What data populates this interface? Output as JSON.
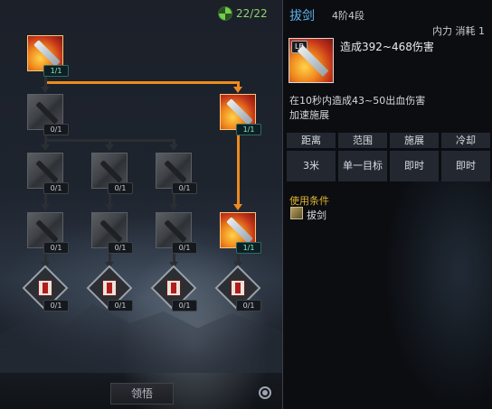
{
  "tree": {
    "points": "22/22",
    "learn_button": "领悟",
    "nodes": {
      "root": "1/1",
      "r1_left": "0/1",
      "r1_right": "1/1",
      "r2_a": "0/1",
      "r2_b": "0/1",
      "r2_c": "0/1",
      "r3_a": "0/1",
      "r3_b": "0/1",
      "r3_c": "0/1",
      "r3_d": "1/1",
      "r4_a": "0/1",
      "r4_b": "0/1",
      "r4_c": "0/1",
      "r4_d": "0/1"
    }
  },
  "detail": {
    "name": "拔剑",
    "rank": "4阶4段",
    "cost": "内力 消耗 1",
    "icon_tag": "LB",
    "damage": "造成392~468伤害",
    "effects": [
      "在10秒内造成43~50出血伤害",
      "加速施展"
    ],
    "stats": {
      "headers": [
        "距离",
        "范围",
        "施展",
        "冷却"
      ],
      "values": [
        "3米",
        "单一目标",
        "即时",
        "即时"
      ]
    },
    "condition_title": "使用条件",
    "condition": "拔剑"
  },
  "colors": {
    "accent_orange": "#f08a1e",
    "name_blue": "#5fb4ea",
    "condition_gold": "#e0b430",
    "points_green": "#8fd36a"
  }
}
